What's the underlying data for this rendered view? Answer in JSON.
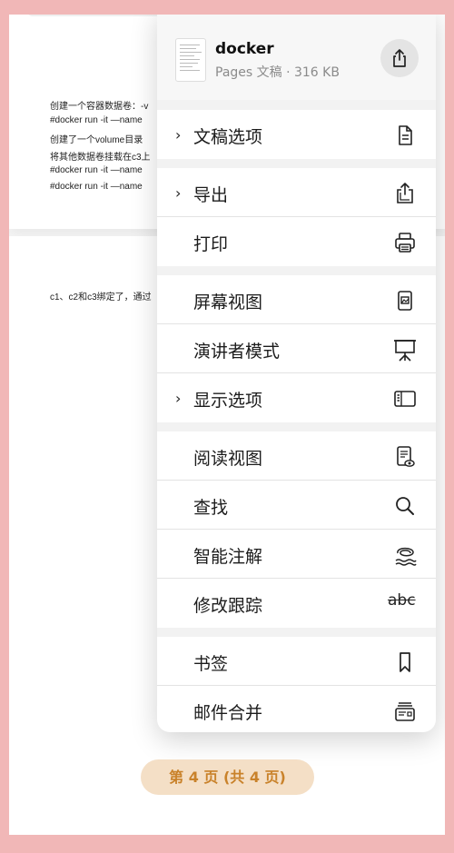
{
  "document": {
    "page1_lines": [
      "创建一个容器数据卷：-v",
      "#docker run -it —name",
      "创建了一个volume目录",
      "将其他数据卷挂载在c3上",
      "#docker run -it —name",
      "#docker run -it —name"
    ],
    "page2_lines": [
      "c1、c2和c3绑定了，通过"
    ]
  },
  "menu": {
    "file_name": "docker",
    "file_meta": "Pages 文稿 · 316 KB",
    "share_icon": "share-icon",
    "groups": [
      [
        {
          "label": "文稿选项",
          "has_chevron": true,
          "icon": "document-icon"
        }
      ],
      [
        {
          "label": "导出",
          "has_chevron": true,
          "icon": "export-icon"
        },
        {
          "label": "打印",
          "has_chevron": false,
          "icon": "printer-icon"
        }
      ],
      [
        {
          "label": "屏幕视图",
          "has_chevron": false,
          "icon": "screen-view-icon"
        },
        {
          "label": "演讲者模式",
          "has_chevron": false,
          "icon": "presenter-icon"
        },
        {
          "label": "显示选项",
          "has_chevron": true,
          "icon": "sidebar-icon"
        }
      ],
      [
        {
          "label": "阅读视图",
          "has_chevron": false,
          "icon": "reading-view-icon"
        },
        {
          "label": "查找",
          "has_chevron": false,
          "icon": "search-icon"
        },
        {
          "label": "智能注解",
          "has_chevron": false,
          "icon": "smart-annotation-icon"
        },
        {
          "label": "修改跟踪",
          "has_chevron": false,
          "icon": "track-changes-icon"
        }
      ],
      [
        {
          "label": "书签",
          "has_chevron": false,
          "icon": "bookmark-icon"
        },
        {
          "label": "邮件合并",
          "has_chevron": false,
          "icon": "mail-merge-icon"
        }
      ]
    ],
    "chevron_glyph": "›",
    "track_changes_text": "abc"
  },
  "footer": {
    "page_indicator": "第 4 页 (共 4 页)"
  },
  "colors": {
    "frame": "#f1b7b7",
    "pill_bg": "#f4dfc6",
    "pill_text": "#c9822a"
  }
}
